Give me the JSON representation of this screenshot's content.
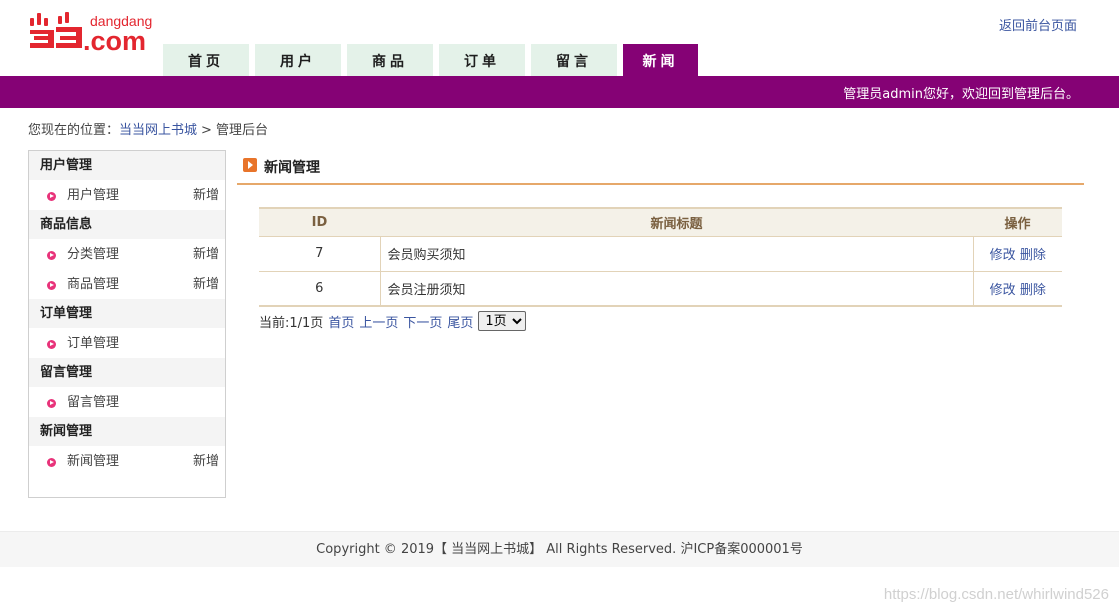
{
  "header": {
    "logo_text": "dangdang",
    "logo_suffix": ".com",
    "return_link": "返回前台页面"
  },
  "nav": {
    "tabs": [
      {
        "label": "首页"
      },
      {
        "label": "用户"
      },
      {
        "label": "商品"
      },
      {
        "label": "订单"
      },
      {
        "label": "留言"
      },
      {
        "label": "新闻",
        "active": true
      }
    ]
  },
  "welcome": "管理员admin您好，欢迎回到管理后台。",
  "breadcrumb": {
    "prefix": "您现在的位置：",
    "home": "当当网上书城",
    "separator": ">",
    "current": "管理后台"
  },
  "sidebar": {
    "groups": [
      {
        "title": "用户管理",
        "items": [
          {
            "label": "用户管理",
            "add": "新增"
          }
        ]
      },
      {
        "title": "商品信息",
        "items": [
          {
            "label": "分类管理",
            "add": "新增"
          },
          {
            "label": "商品管理",
            "add": "新增"
          }
        ]
      },
      {
        "title": "订单管理",
        "items": [
          {
            "label": "订单管理",
            "add": ""
          }
        ]
      },
      {
        "title": "留言管理",
        "items": [
          {
            "label": "留言管理",
            "add": ""
          }
        ]
      },
      {
        "title": "新闻管理",
        "items": [
          {
            "label": "新闻管理",
            "add": "新增"
          }
        ]
      }
    ]
  },
  "main": {
    "section_title": "新闻管理",
    "table": {
      "headers": [
        "ID",
        "新闻标题",
        "操作"
      ],
      "rows": [
        {
          "id": "7",
          "title": "会员购买须知",
          "edit": "修改",
          "delete": "删除"
        },
        {
          "id": "6",
          "title": "会员注册须知",
          "edit": "修改",
          "delete": "删除"
        }
      ]
    },
    "pager": {
      "status": "当前:1/1页",
      "first": "首页",
      "prev": "上一页",
      "next": "下一页",
      "last": "尾页",
      "selected_page": "1页"
    }
  },
  "footer": {
    "copyright": "Copyright © 2019【 当当网上书城】 All Rights Reserved. 沪ICP备案000001号"
  },
  "watermark": "https://blog.csdn.net/whirlwind526",
  "colors": {
    "brand_purple": "#850275",
    "nav_tab_bg": "#e4f2e9",
    "logo_red": "#e3262f",
    "link_blue": "#3a55a0",
    "accent_orange": "#e6a86a"
  }
}
